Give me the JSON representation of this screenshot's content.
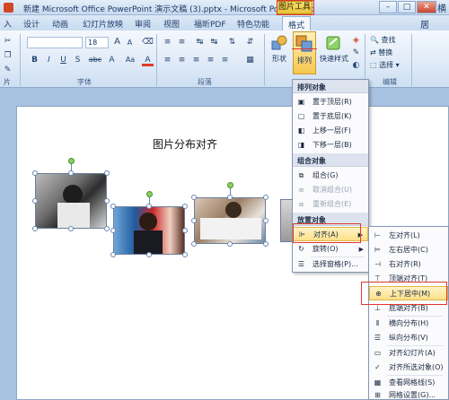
{
  "window": {
    "title": "新建 Microsoft Office PowerPoint 演示文稿 (3).pptx - Microsoft PowerPoint",
    "context_tab": "图片工具",
    "controls": {
      "minimize": "–",
      "maximize": "□",
      "close": "✕"
    },
    "side_text_1": "横向",
    "side_text_2": "居"
  },
  "tabs": [
    "入",
    "设计",
    "动画",
    "幻灯片放映",
    "审阅",
    "视图",
    "福昕PDF",
    "特色功能",
    "格式"
  ],
  "ribbon": {
    "font_name": "",
    "font_size": "18",
    "group_labels": [
      "片",
      "字体",
      "段落",
      "编辑"
    ],
    "shape_label": "形状",
    "arrange_label": "排列",
    "quick_style_label": "快速样式",
    "edit_items": [
      "查找",
      "替换",
      "选择"
    ],
    "font_buttons": [
      "B",
      "I",
      "U",
      "S",
      "abc",
      "A",
      "Aa",
      "A"
    ],
    "font_size_buttons": [
      "A",
      "A"
    ],
    "para_icons": [
      "≡",
      "≡",
      "↹",
      "↹",
      "⇅"
    ],
    "align_icons": [
      "≡",
      "≡",
      "≡",
      "≡",
      "≡"
    ]
  },
  "slide": {
    "title": "图片分布对齐"
  },
  "arrange_menu": {
    "sections": [
      {
        "header": "排列对象",
        "items": [
          {
            "label": "置于顶层(R)",
            "icon": "bring-front-icon",
            "disabled": false
          },
          {
            "label": "置于底层(K)",
            "icon": "send-back-icon",
            "disabled": false
          },
          {
            "label": "上移一层(F)",
            "icon": "bring-forward-icon",
            "disabled": false
          },
          {
            "label": "下移一层(B)",
            "icon": "send-backward-icon",
            "disabled": false
          }
        ]
      },
      {
        "header": "组合对象",
        "items": [
          {
            "label": "组合(G)",
            "icon": "group-icon",
            "disabled": false
          },
          {
            "label": "取消组合(U)",
            "icon": "ungroup-icon",
            "disabled": true
          },
          {
            "label": "重新组合(E)",
            "icon": "regroup-icon",
            "disabled": true
          }
        ]
      },
      {
        "header": "放置对象",
        "items": [
          {
            "label": "对齐(A)",
            "icon": "align-icon",
            "disabled": false,
            "submenu": true
          },
          {
            "label": "旋转(O)",
            "icon": "rotate-icon",
            "disabled": false,
            "submenu": true
          },
          {
            "label": "选择窗格(P)...",
            "icon": "selection-pane-icon",
            "disabled": false
          }
        ]
      }
    ]
  },
  "align_submenu": {
    "items": [
      {
        "label": "左对齐(L)",
        "icon": "align-left-icon"
      },
      {
        "label": "左右居中(C)",
        "icon": "align-center-icon"
      },
      {
        "label": "右对齐(R)",
        "icon": "align-right-icon"
      },
      {
        "label": "顶端对齐(T)",
        "icon": "align-top-icon"
      },
      {
        "label": "上下居中(M)",
        "icon": "align-middle-icon"
      },
      {
        "label": "底端对齐(B)",
        "icon": "align-bottom-icon"
      },
      {
        "label": "横向分布(H)",
        "icon": "distribute-horizontal-icon"
      },
      {
        "label": "纵向分布(V)",
        "icon": "distribute-vertical-icon"
      },
      {
        "label": "对齐幻灯片(A)",
        "icon": "align-to-slide-icon"
      },
      {
        "label": "对齐所选对象(O)",
        "icon": "align-selected-icon"
      },
      {
        "label": "查看网格线(S)",
        "icon": "view-gridlines-icon"
      },
      {
        "label": "网格设置(G)...",
        "icon": "grid-settings-icon"
      }
    ],
    "highlighted": "上下居中(M)"
  },
  "colors": {
    "highlight": "#ffe08a",
    "annotation_red": "#e0382e",
    "rotation_handle": "#84d45f"
  }
}
